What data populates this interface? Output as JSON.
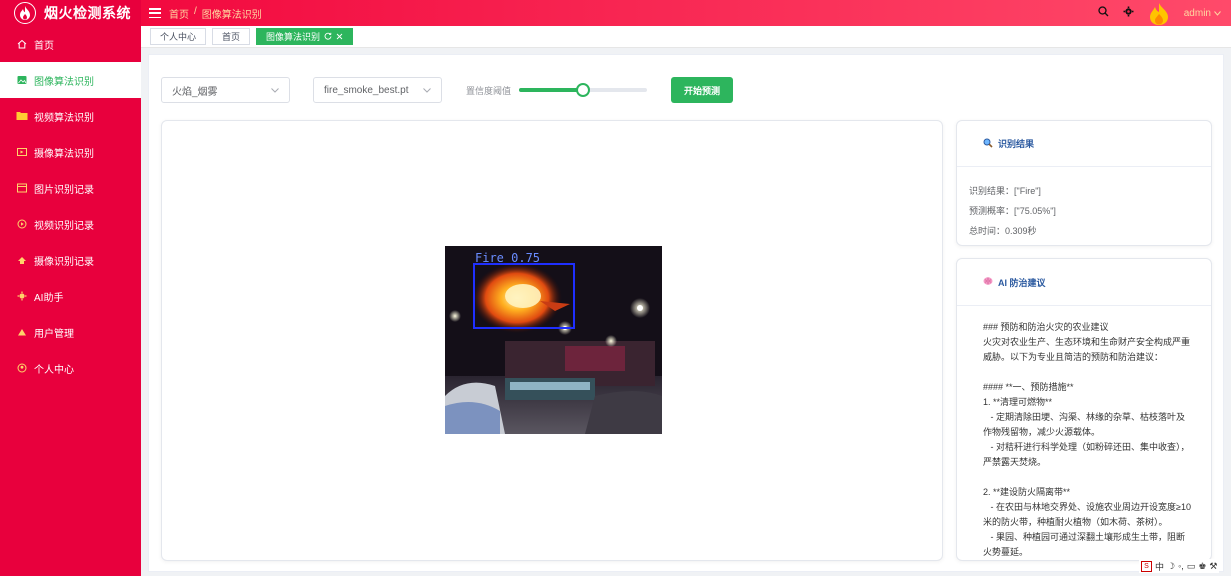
{
  "app": {
    "title": "烟火检测系统"
  },
  "sidebar": {
    "items": [
      {
        "label": "首页",
        "icon": "home-icon"
      },
      {
        "label": "图像算法识别",
        "icon": "image-icon",
        "active": true
      },
      {
        "label": "视频算法识别",
        "icon": "video-icon"
      },
      {
        "label": "摄像算法识别",
        "icon": "camera-icon"
      },
      {
        "label": "图片识别记录",
        "icon": "image-record-icon"
      },
      {
        "label": "视频识别记录",
        "icon": "video-record-icon"
      },
      {
        "label": "摄像识别记录",
        "icon": "camera-record-icon"
      },
      {
        "label": "AI助手",
        "icon": "ai-icon"
      },
      {
        "label": "用户管理",
        "icon": "user-icon"
      },
      {
        "label": "个人中心",
        "icon": "profile-icon"
      }
    ]
  },
  "header": {
    "breadcrumb": [
      "首页",
      "图像算法识别"
    ],
    "breadcrumb_sep": "/",
    "user": "admin"
  },
  "tabs": [
    {
      "label": "个人中心"
    },
    {
      "label": "首页"
    },
    {
      "label": "图像算法识别",
      "active": true
    }
  ],
  "controls": {
    "category": "火焰_烟雾",
    "model": "fire_smoke_best.pt",
    "threshold_label": "置信度阈值",
    "threshold_value": 0.5,
    "predict_button": "开始预测"
  },
  "detection": {
    "label": "Fire 0.75",
    "box_color": "#1f2fff"
  },
  "result": {
    "title": "识别结果",
    "lines": [
      "识别结果：[\"Fire\"]",
      "预测概率：[\"75.05%\"]",
      "总时间：0.309秒"
    ]
  },
  "advice": {
    "title": "AI 防治建议",
    "text": "### 预防和防治火灾的农业建议\n火灾对农业生产、生态环境和生命财产安全构成严重威胁。以下为专业且简洁的预防和防治建议：\n\n#### **一、预防措施**\n1. **清理可燃物**\n   - 定期清除田埂、沟渠、林缘的杂草、枯枝落叶及作物残留物，减少火源载体。\n   - 对秸秆进行科学处理（如粉碎还田、集中收查），严禁露天焚烧。\n\n2. **建设防火隔离带**\n   - 在农田与林地交界处、设施农业周边开设宽度≥10米的防火带，种植耐火植物（如木荷、茶树）。\n   - 果园、种植园可通过深翻土壤形成生土带，阻断火势蔓延。"
  },
  "tray": {
    "ime": "中"
  },
  "colors": {
    "brand": "#e8003d",
    "accent": "#2db55d",
    "crumb": "#ffd7a0"
  }
}
